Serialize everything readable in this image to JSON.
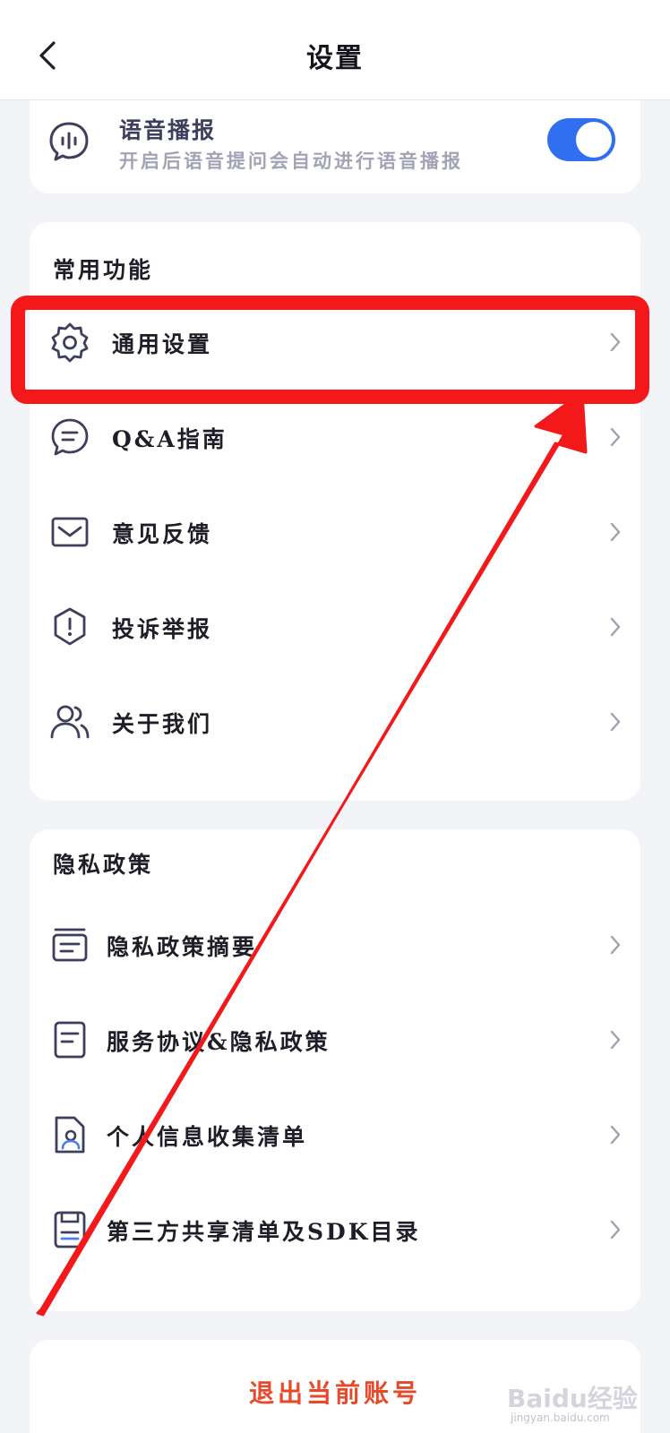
{
  "header": {
    "title": "设置"
  },
  "voice": {
    "title": "语音播报",
    "description": "开启后语音提问会自动进行语音播报",
    "enabled": true
  },
  "common": {
    "section_title": "常用功能",
    "items": [
      {
        "label": "通用设置",
        "icon": "gear-icon"
      },
      {
        "label": "Q&A指南",
        "icon": "chat-bubble-icon"
      },
      {
        "label": "意见反馈",
        "icon": "envelope-icon"
      },
      {
        "label": "投诉举报",
        "icon": "shield-alert-icon"
      },
      {
        "label": "关于我们",
        "icon": "users-icon"
      }
    ]
  },
  "privacy": {
    "section_title": "隐私政策",
    "items": [
      {
        "label": "隐私政策摘要",
        "icon": "summary-list-icon"
      },
      {
        "label": "服务协议&隐私政策",
        "icon": "document-icon"
      },
      {
        "label": "个人信息收集清单",
        "icon": "personal-file-icon"
      },
      {
        "label": "第三方共享清单及SDK目录",
        "icon": "sdk-file-icon"
      }
    ]
  },
  "logout": {
    "label": "退出当前账号"
  },
  "colors": {
    "accent": "#2f6ff0",
    "logout": "#e64a2b",
    "annotation": "#f3191a"
  },
  "watermark": {
    "brand": "Baidu经验",
    "url": "jingyan.baidu.com"
  }
}
